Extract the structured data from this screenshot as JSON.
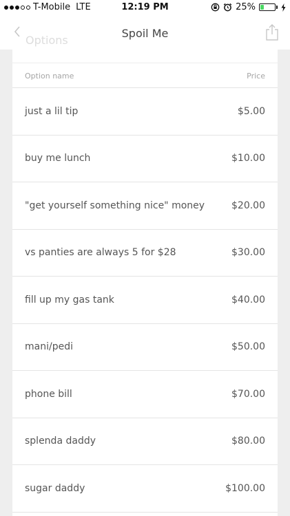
{
  "status_bar": {
    "carrier": "T-Mobile",
    "network": "LTE",
    "time": "12:19 PM",
    "battery": "25%",
    "battery_level": 0.25,
    "icons": [
      "signal-dots-icon",
      "lock-rotation-icon",
      "alarm-icon",
      "battery-icon",
      "charging-bolt-icon"
    ]
  },
  "nav": {
    "title": "Spoil Me",
    "ghost_title": "Options",
    "back_icon": "chevron-left-icon",
    "share_icon": "share-icon"
  },
  "table": {
    "headers": {
      "name": "Option name",
      "price": "Price"
    },
    "rows": [
      {
        "name": "just a lil tip",
        "price": "$5.00"
      },
      {
        "name": "buy me lunch",
        "price": "$10.00"
      },
      {
        "name": "\"get yourself something nice\" money",
        "price": "$20.00"
      },
      {
        "name": "vs panties are always 5 for $28",
        "price": "$30.00"
      },
      {
        "name": "fill up my gas tank",
        "price": "$40.00"
      },
      {
        "name": "mani/pedi",
        "price": "$50.00"
      },
      {
        "name": "phone bill",
        "price": "$70.00"
      },
      {
        "name": "splenda daddy",
        "price": "$80.00"
      },
      {
        "name": "sugar daddy",
        "price": "$100.00"
      }
    ]
  },
  "colors": {
    "background": "#eeeeee",
    "card": "#ffffff",
    "battery_fill": "#4cd964"
  }
}
